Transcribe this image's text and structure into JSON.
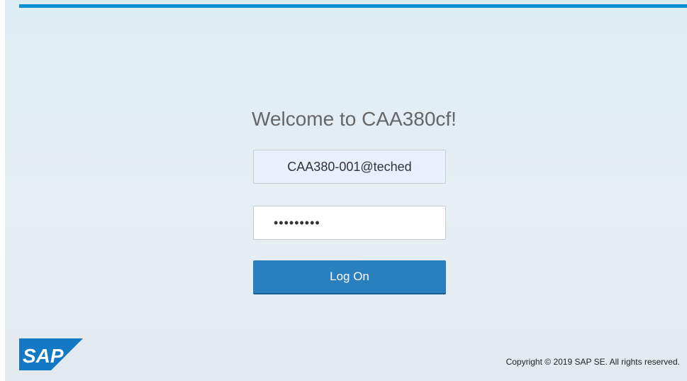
{
  "login": {
    "title": "Welcome to CAA380cf!",
    "username_value": "CAA380-001@teched",
    "password_masked": "•••••••••",
    "logon_label": "Log On"
  },
  "footer": {
    "logo_icon": "sap-logo",
    "logo_text": "SAP",
    "copyright": "Copyright © 2019 SAP SE. All rights reserved."
  },
  "colors": {
    "accent": "#0a8fd6",
    "button": "#2a7fbe",
    "logo": "#1479c4"
  }
}
